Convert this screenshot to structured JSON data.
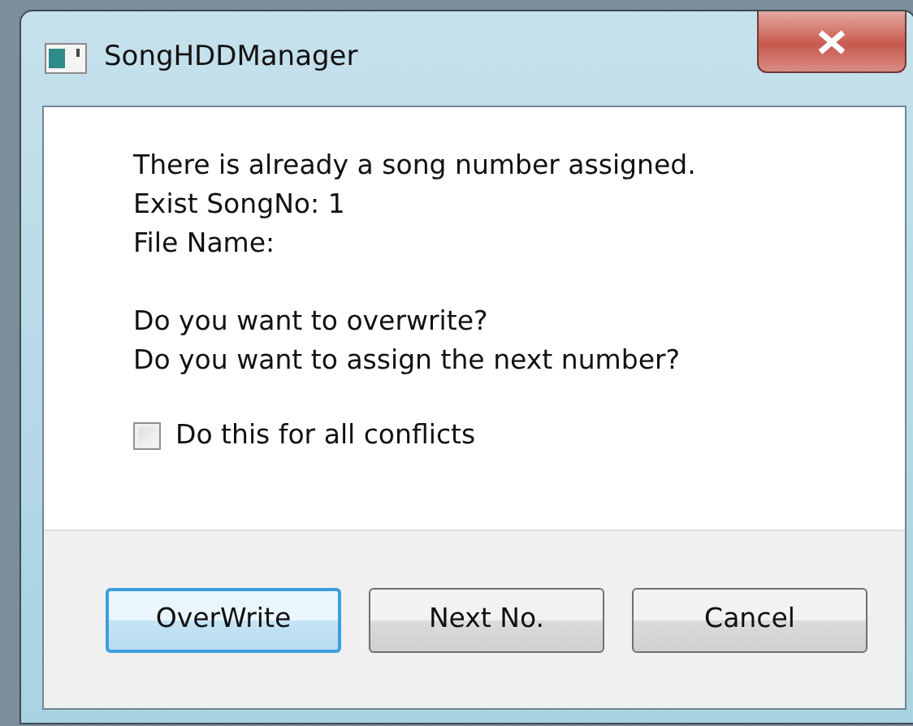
{
  "window": {
    "title": "SongHDDManager"
  },
  "message_lines": [
    "There is already a song number assigned.",
    "Exist SongNo: 1",
    "File Name:"
  ],
  "question_lines": [
    "Do you want to overwrite?",
    "Do you want to assign the next number?"
  ],
  "checkbox": {
    "label": "Do this for all conflicts",
    "checked": false
  },
  "buttons": [
    {
      "label": "OverWrite",
      "default": true
    },
    {
      "label": "Next No.",
      "default": false
    },
    {
      "label": "Cancel",
      "default": false
    }
  ]
}
